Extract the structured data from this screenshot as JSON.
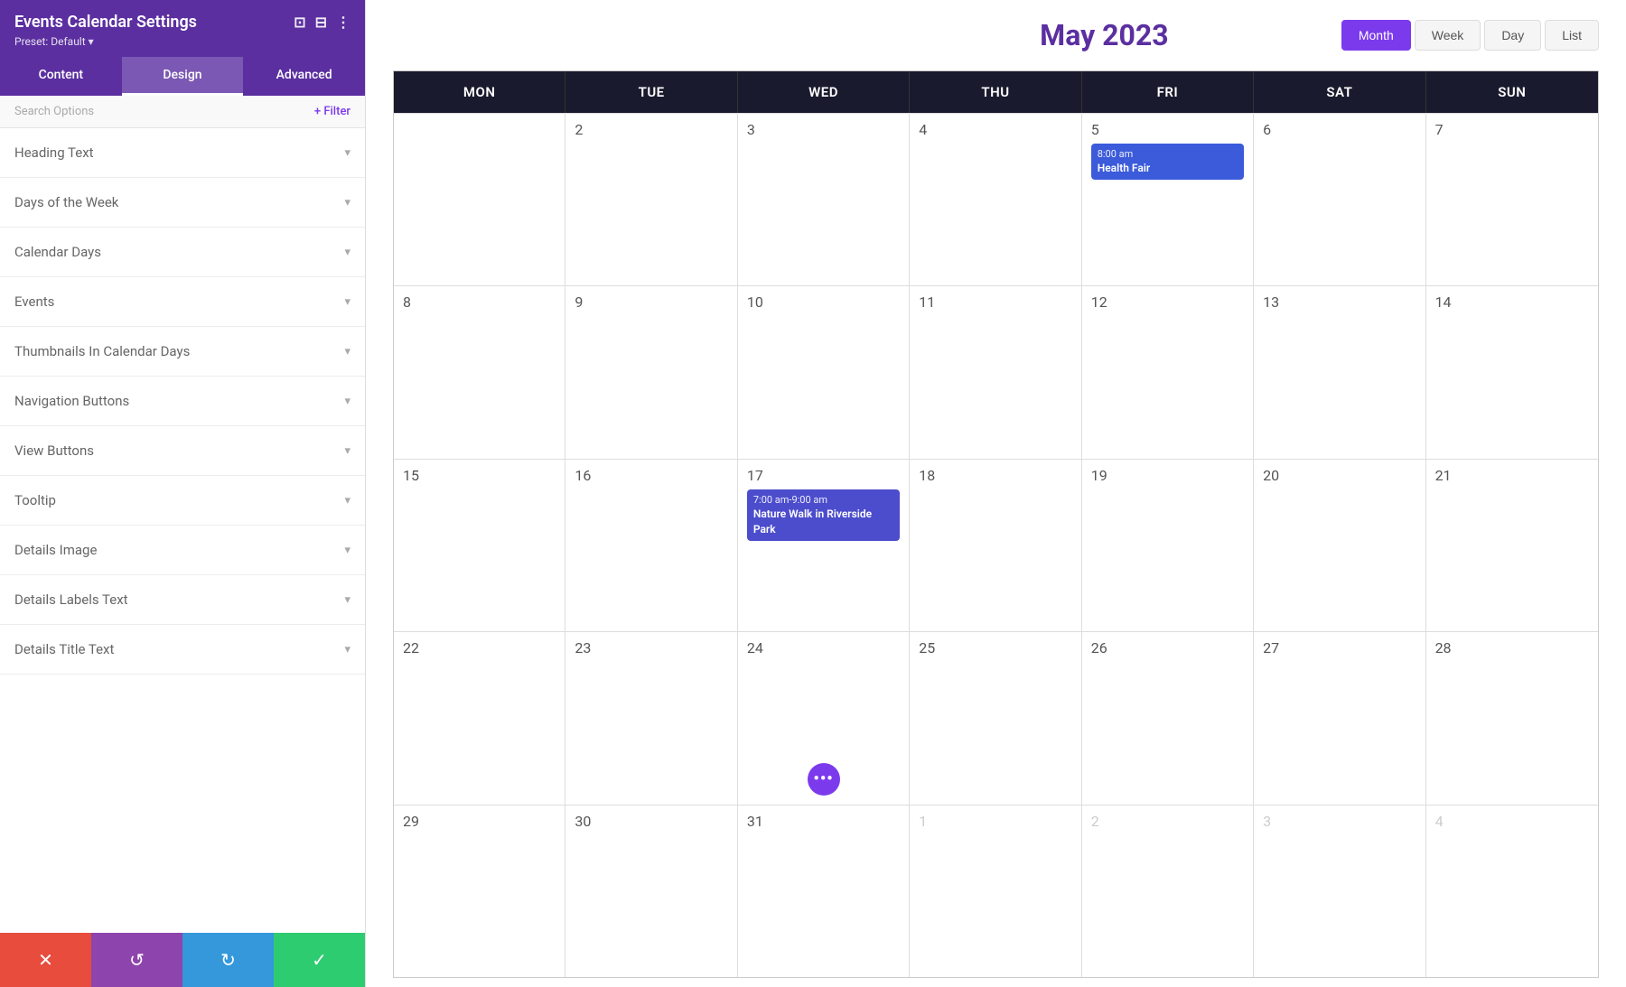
{
  "sidebar": {
    "title": "Events Calendar Settings",
    "title_icons": [
      "⊡",
      "⊟",
      "⋮"
    ],
    "preset": "Preset: Default ▾",
    "tabs": [
      {
        "label": "Content",
        "active": false
      },
      {
        "label": "Design",
        "active": true
      },
      {
        "label": "Advanced",
        "active": false
      }
    ],
    "search_label": "Search Options",
    "filter_label": "+ Filter",
    "sections": [
      {
        "label": "Heading Text"
      },
      {
        "label": "Days of the Week"
      },
      {
        "label": "Calendar Days"
      },
      {
        "label": "Events"
      },
      {
        "label": "Thumbnails In Calendar Days"
      },
      {
        "label": "Navigation Buttons"
      },
      {
        "label": "View Buttons"
      },
      {
        "label": "Tooltip"
      },
      {
        "label": "Details Image"
      },
      {
        "label": "Details Labels Text"
      },
      {
        "label": "Details Title Text"
      }
    ],
    "actions": [
      {
        "label": "✕",
        "type": "close"
      },
      {
        "label": "↺",
        "type": "undo"
      },
      {
        "label": "↻",
        "type": "redo"
      },
      {
        "label": "✓",
        "type": "save"
      }
    ]
  },
  "calendar": {
    "title": "May 2023",
    "title_color": "#5b2fa0",
    "view_buttons": [
      {
        "label": "Month",
        "active": true
      },
      {
        "label": "Week",
        "active": false
      },
      {
        "label": "Day",
        "active": false
      },
      {
        "label": "List",
        "active": false
      }
    ],
    "day_headers": [
      "MON",
      "TUE",
      "WED",
      "THU",
      "FRI",
      "SAT",
      "SUN"
    ],
    "rows": [
      {
        "cells": [
          {
            "num": "",
            "other": true
          },
          {
            "num": "2"
          },
          {
            "num": "3"
          },
          {
            "num": "4"
          },
          {
            "num": "5",
            "events": [
              {
                "time": "8:00 am",
                "name": "Health Fair",
                "color": "blue"
              }
            ]
          },
          {
            "num": "6"
          },
          {
            "num": "7"
          }
        ]
      },
      {
        "cells": [
          {
            "num": "8"
          },
          {
            "num": "9"
          },
          {
            "num": "10"
          },
          {
            "num": "11"
          },
          {
            "num": "12"
          },
          {
            "num": "13"
          },
          {
            "num": "14"
          }
        ]
      },
      {
        "cells": [
          {
            "num": "15"
          },
          {
            "num": "16"
          },
          {
            "num": "17",
            "events": [
              {
                "time": "7:00 am-9:00 am",
                "name": "Nature Walk in Riverside Park",
                "color": "indigo"
              }
            ]
          },
          {
            "num": "18"
          },
          {
            "num": "19"
          },
          {
            "num": "20"
          },
          {
            "num": "21"
          }
        ]
      },
      {
        "cells": [
          {
            "num": "22"
          },
          {
            "num": "23"
          },
          {
            "num": "24",
            "has_dots": true
          },
          {
            "num": "25"
          },
          {
            "num": "26"
          },
          {
            "num": "27"
          },
          {
            "num": "28"
          }
        ]
      },
      {
        "cells": [
          {
            "num": "29"
          },
          {
            "num": "30"
          },
          {
            "num": "31"
          },
          {
            "num": "1",
            "other": true
          },
          {
            "num": "2",
            "other": true
          },
          {
            "num": "3",
            "other": true
          },
          {
            "num": "4",
            "other": true
          }
        ]
      }
    ]
  }
}
